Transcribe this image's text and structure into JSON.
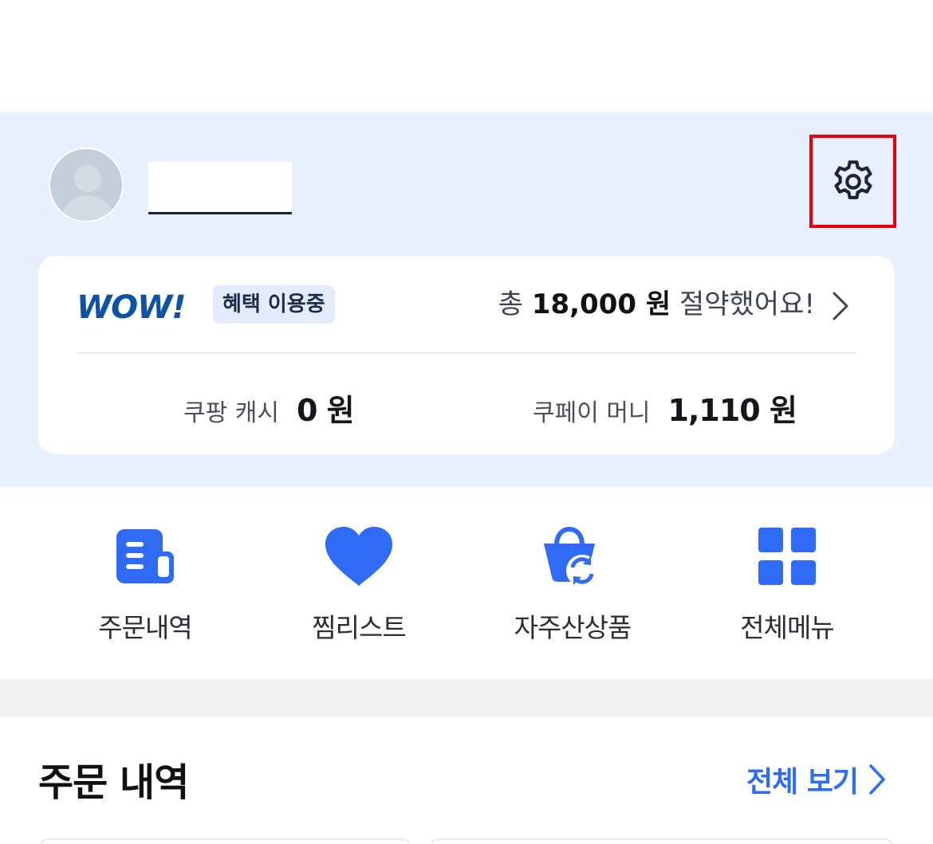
{
  "profile": {
    "name_hidden": true
  },
  "wow": {
    "logo_text": "WOW!",
    "badge": "혜택 이용중",
    "savings_prefix": "총",
    "savings_amount": "18,000 원",
    "savings_suffix": "절약했어요!"
  },
  "balances": {
    "coupang_cash_label": "쿠팡 캐시",
    "coupang_cash_value": "0 원",
    "coupay_money_label": "쿠페이 머니",
    "coupay_money_value": "1,110 원"
  },
  "quick_menu": [
    {
      "label": "주문내역",
      "icon": "receipt-icon"
    },
    {
      "label": "찜리스트",
      "icon": "heart-icon"
    },
    {
      "label": "자주산상품",
      "icon": "reorder-bag-icon"
    },
    {
      "label": "전체메뉴",
      "icon": "grid-icon"
    }
  ],
  "orders_section": {
    "title": "주문 내역",
    "view_all": "전체 보기"
  },
  "colors": {
    "accent": "#2c6bff",
    "wow_blue": "#0e52a6",
    "profile_bg": "#e8efff",
    "highlight_red": "#e8000b"
  }
}
